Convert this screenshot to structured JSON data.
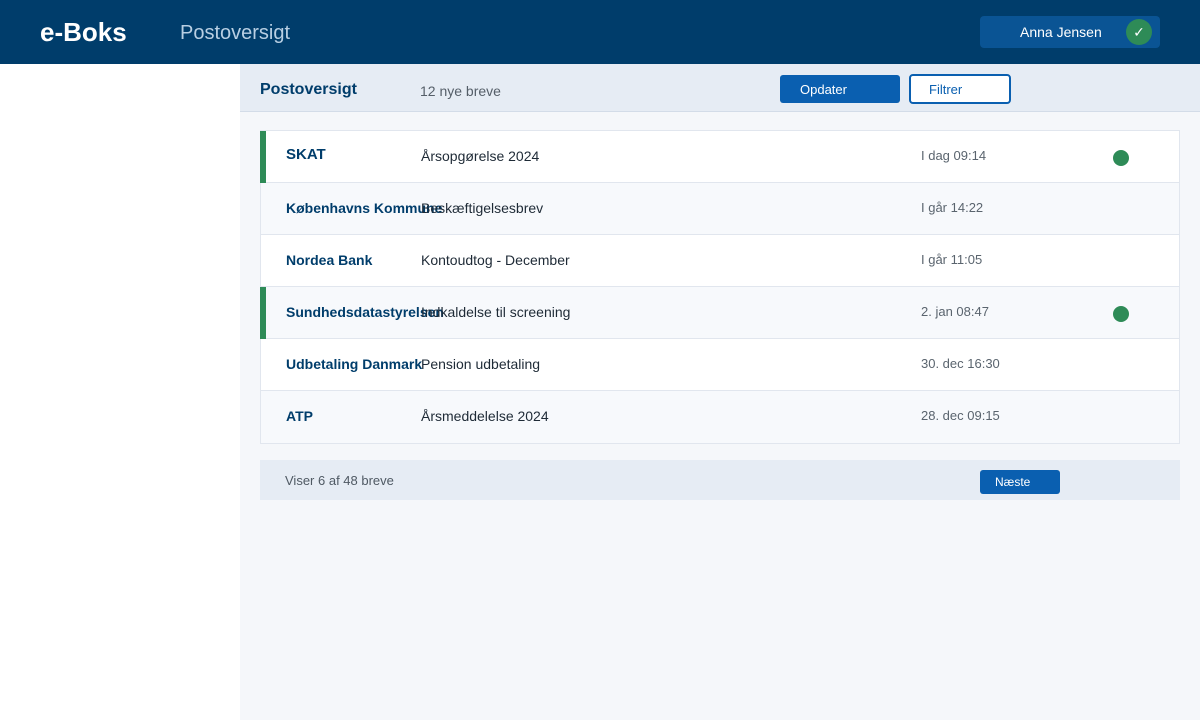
{
  "header": {
    "logo": "e-Boks",
    "title": "Postoversigt",
    "user_name": "Anna Jensen",
    "user_icon": "check-icon"
  },
  "toolbar": {
    "title": "Postoversigt",
    "count_text": "12 nye breve",
    "refresh_label": "Opdater",
    "filter_label": "Filtrer"
  },
  "mail": [
    {
      "sender": "SKAT",
      "subject": "Årsopgørelse 2024",
      "date": "I dag 09:14",
      "unread": true
    },
    {
      "sender": "Københavns Kommune",
      "subject": "Beskæftigelsesbrev",
      "date": "I går 14:22",
      "unread": false
    },
    {
      "sender": "Nordea Bank",
      "subject": "Kontoudtog - December",
      "date": "I går 11:05",
      "unread": false
    },
    {
      "sender": "Sundhedsdatastyrelsen",
      "subject": "Indkaldelse til screening",
      "date": "2. jan 08:47",
      "unread": true
    },
    {
      "sender": "Udbetaling Danmark",
      "subject": "Pension udbetaling",
      "date": "30. dec 16:30",
      "unread": false
    },
    {
      "sender": "ATP",
      "subject": "Årsmeddelelse 2024",
      "date": "28. dec 09:15",
      "unread": false
    }
  ],
  "pager": {
    "text": "Viser 6 af 48 breve",
    "next_label": "Næste"
  },
  "colors": {
    "header_bg": "#003d6b",
    "primary": "#0a5fb0",
    "unread": "#2e8b57",
    "sender_text": "#003d6b"
  }
}
